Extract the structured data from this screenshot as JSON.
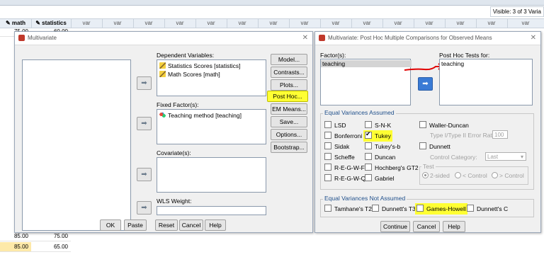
{
  "spreadsheet": {
    "visible_text": "Visible: 3 of 3 Varia",
    "columns": [
      "math",
      "statistics",
      "var",
      "var",
      "var",
      "var",
      "var",
      "var",
      "var",
      "var",
      "var",
      "var",
      "var",
      "var",
      "var",
      "var",
      "var"
    ],
    "partial_row_values": [
      "75.00",
      "60.00"
    ],
    "rows": [
      {
        "math": "85.00",
        "statistics": "75.00"
      },
      {
        "math": "85.00",
        "statistics": "65.00"
      }
    ]
  },
  "multivariate": {
    "title": "Multivariate",
    "dependent_label": "Dependent Variables:",
    "dependent_items": [
      "Statistics Scores [statistics]",
      "Math Scores [math]"
    ],
    "fixed_label": "Fixed Factor(s):",
    "fixed_items": [
      "Teaching method [teaching]"
    ],
    "covariate_label": "Covariate(s):",
    "wls_label": "WLS Weight:",
    "side_buttons": [
      "Model...",
      "Contrasts...",
      "Plots...",
      "Post Hoc...",
      "EM Means...",
      "Save...",
      "Options...",
      "Bootstrap..."
    ],
    "bottom_buttons": [
      "OK",
      "Paste",
      "Reset",
      "Cancel",
      "Help"
    ]
  },
  "posthoc": {
    "title": "Multivariate: Post Hoc Multiple Comparisons for Observed Means",
    "factors_label": "Factor(s):",
    "factors_items": [
      "teaching"
    ],
    "tests_for_label": "Post Hoc Tests for:",
    "tests_for_items": [
      "teaching"
    ],
    "equal_assumed_title": "Equal Variances Assumed",
    "col1": [
      "LSD",
      "Bonferroni",
      "Sidak",
      "Scheffe",
      "R-E-G-W-F",
      "R-E-G-W-Q"
    ],
    "col2": [
      "S-N-K",
      "Tukey",
      "Tukey's-b",
      "Duncan",
      "Hochberg's GT2",
      "Gabriel"
    ],
    "waller": "Waller-Duncan",
    "type_ratio_label": "Type I/Type II Error Ratio:",
    "type_ratio_value": "100",
    "dunnett": "Dunnett",
    "control_category_label": "Control Category:",
    "control_category_value": "Last",
    "test_label": "Test",
    "test_options": [
      "2-sided",
      "< Control",
      "> Control"
    ],
    "not_assumed_title": "Equal Variances Not Assumed",
    "not_assumed": [
      "Tamhane's T2",
      "Dunnett's T3",
      "Games-Howell",
      "Dunnett's C"
    ],
    "buttons": [
      "Continue",
      "Cancel",
      "Help"
    ]
  }
}
